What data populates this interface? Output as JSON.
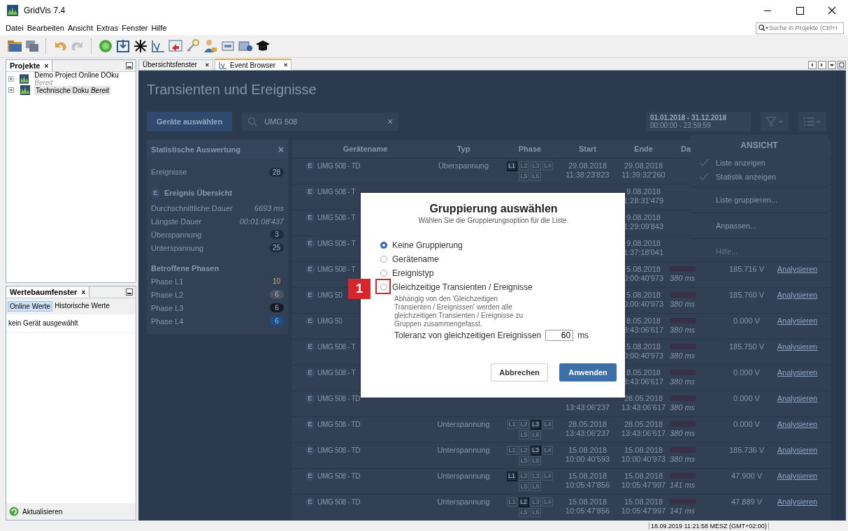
{
  "window": {
    "title": "GridVis 7.4"
  },
  "menu": [
    "Datei",
    "Bearbeiten",
    "Ansicht",
    "Extras",
    "Fenster",
    "Hilfe"
  ],
  "search": {
    "placeholder": "Suche in Projekte (Ctrl+I"
  },
  "projects_panel": {
    "title": "Projekte",
    "close": "×",
    "items": [
      {
        "label": "Demo Project Online DOku",
        "status": "Bereit",
        "selected": false
      },
      {
        "label": "Technische Doku",
        "status": "Bereit",
        "selected": true
      }
    ]
  },
  "values_panel": {
    "title": "Wertebaumfenster",
    "close": "×",
    "tabs": [
      {
        "label": "Online Werte",
        "selected": true
      },
      {
        "label": "Historische Werte",
        "selected": false
      }
    ],
    "message": "kein Gerät ausgewählt",
    "refresh": "Aktualisieren"
  },
  "editor_tabs": [
    {
      "label": "Übersichtsfenster",
      "close": "×",
      "selected": false,
      "kind": "plain"
    },
    {
      "label": "Event Browser",
      "close": "×",
      "selected": true,
      "kind": "chart"
    }
  ],
  "event_browser": {
    "title": "Transienten und Ereignisse",
    "select_button": "Geräte auswählen",
    "filter": {
      "value": "UMG 508",
      "clear": "×"
    },
    "date_range": {
      "dates": "01.01.2018 - 31.12.2018",
      "times": "00:00:00 - 23:59:59"
    },
    "statistics": {
      "title": "Statistische Auswertung",
      "close": "×",
      "events": {
        "label": "Ereignisse",
        "count": "28"
      },
      "overview": {
        "marker": "E",
        "title": "Ereignis Übersicht"
      },
      "rows": [
        {
          "label": "Durchschnittliche Dauer",
          "value": "6693 ms",
          "kind": "text"
        },
        {
          "label": "Längste Dauer",
          "value": "00:01:08'437",
          "kind": "text"
        },
        {
          "label": "Überspannung",
          "value": "3",
          "kind": "count"
        },
        {
          "label": "Unterspannung",
          "value": "25",
          "kind": "count"
        }
      ],
      "phases_title": "Betroffene Phasen",
      "phases": [
        {
          "label": "Phase L1",
          "count": "10",
          "color": "#3a3f48"
        },
        {
          "label": "Phase L2",
          "count": "6",
          "color": "#4a5363"
        },
        {
          "label": "Phase L3",
          "count": "6",
          "color": "#161c26"
        },
        {
          "label": "Phase L4",
          "count": "6",
          "color": "#1d4f8a"
        }
      ]
    },
    "columns": [
      "Gerätename",
      "Typ",
      "Phase",
      "Start",
      "Ende",
      "Da"
    ],
    "rows": [
      {
        "marker": "E",
        "name": "UMG 508 - TD",
        "type": "Überspannung",
        "phases": [
          {
            "label": "L1",
            "active": true
          },
          {
            "label": "L2",
            "active": false
          },
          {
            "label": "L3",
            "active": false
          },
          {
            "label": "L4",
            "active": false
          },
          {
            "label": "L5",
            "active": false
          },
          {
            "label": "L6",
            "active": false
          }
        ],
        "start": [
          "29.08.2018",
          "11:38:23'823"
        ],
        "end": [
          "29.08.2018",
          "11:39:32'260"
        ]
      },
      {
        "marker": "E",
        "name": "UMG 508 - T",
        "end": [
          "9.08.2018",
          "1:28:31'479"
        ]
      },
      {
        "marker": "E",
        "name": "UMG 508 - T",
        "end": [
          "9.08.2018",
          "1:29:09'843"
        ]
      },
      {
        "marker": "E",
        "name": "UMG 508 - T",
        "end": [
          "9.08.2018",
          "1:37:18'041"
        ]
      },
      {
        "marker": "E",
        "name": "UMG 508 - T",
        "end": [
          "5.08.2018",
          "0:00:40'973"
        ],
        "duration": "380 ms",
        "value": "185.716 V",
        "link": "Analysieren"
      },
      {
        "marker": "E",
        "name": "UMG 50",
        "end": [
          "5.08.2018",
          "0:00:40'973"
        ],
        "duration": "380 ms",
        "value": "185.760 V",
        "link": "Analysieren"
      },
      {
        "marker": "E",
        "name": "UMG 50",
        "end": [
          "8.05.2018",
          "3:43:06'617"
        ],
        "duration": "380 ms",
        "value": "0.000 V",
        "link": "Analysieren"
      },
      {
        "marker": "E",
        "name": "UMG 508 - T",
        "end": [
          "5.08.2018",
          "0:00:40'973"
        ],
        "duration": "380 ms",
        "value": "185.750 V",
        "link": "Analysieren"
      },
      {
        "marker": "E",
        "name": "UMG 508 - T",
        "end": [
          "8.05.2018",
          "3:43:06'617"
        ],
        "duration": "380 ms",
        "value": "0.000 V",
        "link": "Analysieren"
      },
      {
        "marker": "E",
        "name": "UMG 508 - TD",
        "start": [
          "13:43:06'237"
        ],
        "end": [
          "28.05.2018",
          "13:43:06'617"
        ],
        "duration": "380 ms",
        "value": "0.000 V",
        "link": "Analysieren"
      },
      {
        "marker": "E",
        "name": "UMG 508 - TD",
        "type": "Unterspannung",
        "phases": [
          {
            "label": "L1",
            "active": false
          },
          {
            "label": "L2",
            "active": false
          },
          {
            "label": "L3",
            "active": true
          },
          {
            "label": "L4",
            "active": false
          },
          {
            "label": "L5",
            "active": false
          },
          {
            "label": "L6",
            "active": false
          }
        ],
        "start": [
          "28.05.2018",
          "13:43:06'237"
        ],
        "end": [
          "28.05.2018",
          "13:43:06'617"
        ],
        "duration": "380 ms",
        "value": "0.000 V",
        "link": "Analysieren"
      },
      {
        "marker": "E",
        "name": "UMG 508 - TD",
        "type": "Unterspannung",
        "phases": [
          {
            "label": "L1",
            "active": false
          },
          {
            "label": "L2",
            "active": false
          },
          {
            "label": "L3",
            "active": true
          },
          {
            "label": "L4",
            "active": false
          },
          {
            "label": "L5",
            "active": false
          },
          {
            "label": "L6",
            "active": false
          }
        ],
        "start": [
          "15.08.2018",
          "10:00:40'593"
        ],
        "end": [
          "15.08.2018",
          "10:00:40'973"
        ],
        "duration": "380 ms",
        "value": "185.736 V",
        "link": "Analysieren"
      },
      {
        "marker": "E",
        "name": "UMG 508 - TD",
        "type": "Unterspannung",
        "phases": [
          {
            "label": "L1",
            "active": true
          },
          {
            "label": "L2",
            "active": false
          },
          {
            "label": "L3",
            "active": false
          },
          {
            "label": "L4",
            "active": false
          },
          {
            "label": "L5",
            "active": false
          },
          {
            "label": "L6",
            "active": false
          }
        ],
        "start": [
          "15.08.2018",
          "10:05:47'856"
        ],
        "end": [
          "15.08.2018",
          "10:05:47'997"
        ],
        "duration": "141 ms",
        "value": "47.900 V",
        "link": "Analysieren"
      },
      {
        "marker": "E",
        "name": "UMG 508 - TD",
        "type": "Unterspannung",
        "phases": [
          {
            "label": "L1",
            "active": false
          },
          {
            "label": "L2",
            "active": true
          },
          {
            "label": "L3",
            "active": false
          },
          {
            "label": "L4",
            "active": false
          },
          {
            "label": "L5",
            "active": false
          },
          {
            "label": "L6",
            "active": false
          }
        ],
        "start": [
          "15.08.2018",
          "10:05:47'856"
        ],
        "end": [
          "15.08.2018",
          "10:05:47'997"
        ],
        "duration": "141 ms",
        "value": "47.889 V",
        "link": "Analysieren"
      }
    ],
    "view_menu": {
      "title": "ANSICHT",
      "items": [
        {
          "label": "Liste anzeigen",
          "kind": "check",
          "checked": true,
          "disabled": false
        },
        {
          "label": "Statistik anzeigen",
          "kind": "check",
          "checked": true,
          "disabled": false
        },
        {
          "label": "Liste gruppieren...",
          "kind": "action",
          "disabled": false
        },
        {
          "label": "Anpassen...",
          "kind": "action",
          "disabled": false
        },
        {
          "label": "Hilfe...",
          "kind": "action",
          "disabled": true
        }
      ]
    }
  },
  "dialog": {
    "title": "Gruppierung auswählen",
    "subtitle": "Wählen Sie die Gruppierungsoption für die Liste.",
    "options": [
      {
        "label": "Keine Gruppierung",
        "selected": true,
        "highlighted": false
      },
      {
        "label": "Gerätename",
        "selected": false,
        "highlighted": false
      },
      {
        "label": "Ereignistyp",
        "selected": false,
        "highlighted": false
      },
      {
        "label": "Gleichzeitige Transienten / Ereignisse",
        "selected": false,
        "highlighted": true
      }
    ],
    "description": "Abhängig von den 'Gleichzeitigen Transienten / Ereignissen' werden alle gleichzeitigen Transienten / Ereignisse zu Gruppen zusammengefasst.",
    "tolerance": {
      "label": "Toleranz von gleichzeitigen Ereignissen",
      "value": "60",
      "unit": "ms"
    },
    "buttons": [
      {
        "label": "Abbrechen",
        "kind": "secondary"
      },
      {
        "label": "Anwenden",
        "kind": "primary"
      }
    ],
    "callout": "1"
  },
  "status_bar": {
    "clock": "18.09.2019 11:21:58 MESZ (GMT+02:00)"
  }
}
